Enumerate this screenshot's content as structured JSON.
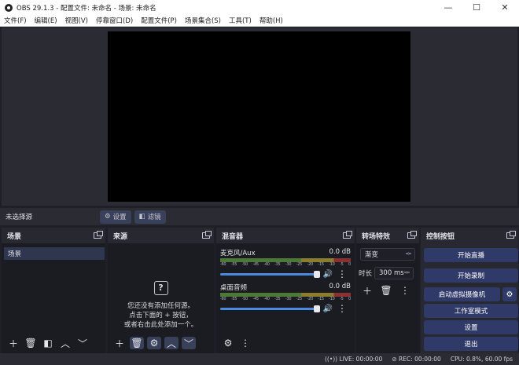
{
  "window": {
    "title": "OBS 29.1.3 - 配置文件: 未命名 - 场景: 未命名",
    "min": "—",
    "max": "☐",
    "close": "✕"
  },
  "menu": [
    "文件(F)",
    "编辑(E)",
    "视图(V)",
    "停靠窗口(D)",
    "配置文件(P)",
    "场景集合(S)",
    "工具(T)",
    "帮助(H)"
  ],
  "source_toolbar": {
    "no_selection": "未选择源",
    "settings": "设置",
    "filters": "滤镜"
  },
  "scenes": {
    "title": "场景",
    "items": [
      "场景"
    ]
  },
  "sources": {
    "title": "来源",
    "empty_lines": [
      "您还没有添加任何源。",
      "点击下面的 + 按钮，",
      "或者右击此处添加一个。"
    ]
  },
  "mixer": {
    "title": "混音器",
    "ticks": [
      "-60",
      "-55",
      "-50",
      "-45",
      "-40",
      "-35",
      "-30",
      "-25",
      "-20",
      "-15",
      "-10",
      "-5",
      "0"
    ],
    "channels": [
      {
        "name": "麦克风/Aux",
        "db": "0.0 dB"
      },
      {
        "name": "桌面音频",
        "db": "0.0 dB"
      }
    ]
  },
  "transitions": {
    "title": "转场特效",
    "type": "渐变",
    "duration_label": "时长",
    "duration": "300 ms"
  },
  "controls": {
    "title": "控制按钮",
    "start_stream": "开始直播",
    "start_record": "开始录制",
    "virtual_cam": "启动虚拟摄像机",
    "studio_mode": "工作室模式",
    "settings": "设置",
    "exit": "退出"
  },
  "status": {
    "live": "LIVE: 00:00:00",
    "rec": "REC: 00:00:00",
    "cpu": "CPU: 0.8%, 60.00 fps"
  },
  "colors": {
    "accent": "#2f3a68",
    "panel": "#272830",
    "canvas": "#000000"
  }
}
